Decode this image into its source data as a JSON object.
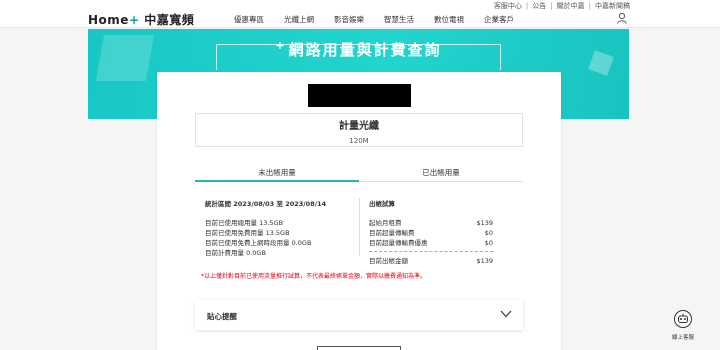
{
  "utility_links": [
    "客服中心",
    "公告",
    "關於中嘉",
    "中嘉新聞稿"
  ],
  "logo": {
    "brand": "Home",
    "plus": "+",
    "name": "中嘉寬頻"
  },
  "nav": [
    "優惠專區",
    "光纖上網",
    "影音娛樂",
    "智慧生活",
    "數位電視",
    "企業客戶"
  ],
  "banner": {
    "plus_mark": "+",
    "title": "網路用量與計費查詢"
  },
  "plan": {
    "name": "計量光纖",
    "speed": "120M"
  },
  "tabs": {
    "current": "未出帳用量",
    "billed": "已出帳用量"
  },
  "stats": {
    "period": "統計區間 2023/08/03 至 2023/08/14",
    "rows": [
      "目前已使用總用量 13.5GB",
      "目前已使用免費用量 13.5GB",
      "目前已使用免費上網時段用量 0.0GB",
      "目前計費用量 0.0GB"
    ]
  },
  "bill": {
    "title": "出帳試算",
    "rows": [
      {
        "label": "起始月租費",
        "value": "$139"
      },
      {
        "label": "目前超量傳輸費",
        "value": "$0"
      },
      {
        "label": "目前超量傳輸費優惠",
        "value": "$0"
      }
    ],
    "total": {
      "label": "目前出帳金額",
      "value": "$139"
    }
  },
  "disclaimer": "*以上僅針對目前已使用流量推行試算，不代表最終帳單金額，實際以繳費通知為準。",
  "reminder": "貼心提醒",
  "support": "線上客服",
  "colors": {
    "accent": "#1fb7ae",
    "banner": "#22d4ce",
    "warning": "#e60012"
  }
}
